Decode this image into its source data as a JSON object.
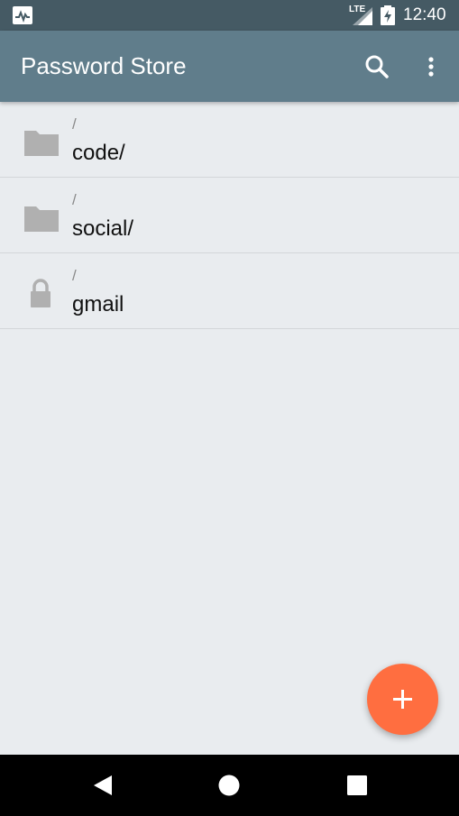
{
  "status_bar": {
    "time": "12:40",
    "network": "LTE",
    "icons": [
      "activity-icon",
      "signal-icon",
      "battery-charging-icon"
    ]
  },
  "app_bar": {
    "title": "Password Store",
    "actions": [
      "search-icon",
      "more-vert-icon"
    ],
    "color": "#607d8b"
  },
  "list": {
    "items": [
      {
        "path": "/",
        "name": "code/",
        "icon": "folder-icon"
      },
      {
        "path": "/",
        "name": "social/",
        "icon": "folder-icon"
      },
      {
        "path": "/",
        "name": "gmail",
        "icon": "lock-icon"
      }
    ]
  },
  "fab": {
    "icon": "add-icon",
    "color": "#ff6e40"
  },
  "nav_bar": {
    "buttons": [
      "back-icon",
      "home-icon",
      "recents-icon"
    ]
  }
}
